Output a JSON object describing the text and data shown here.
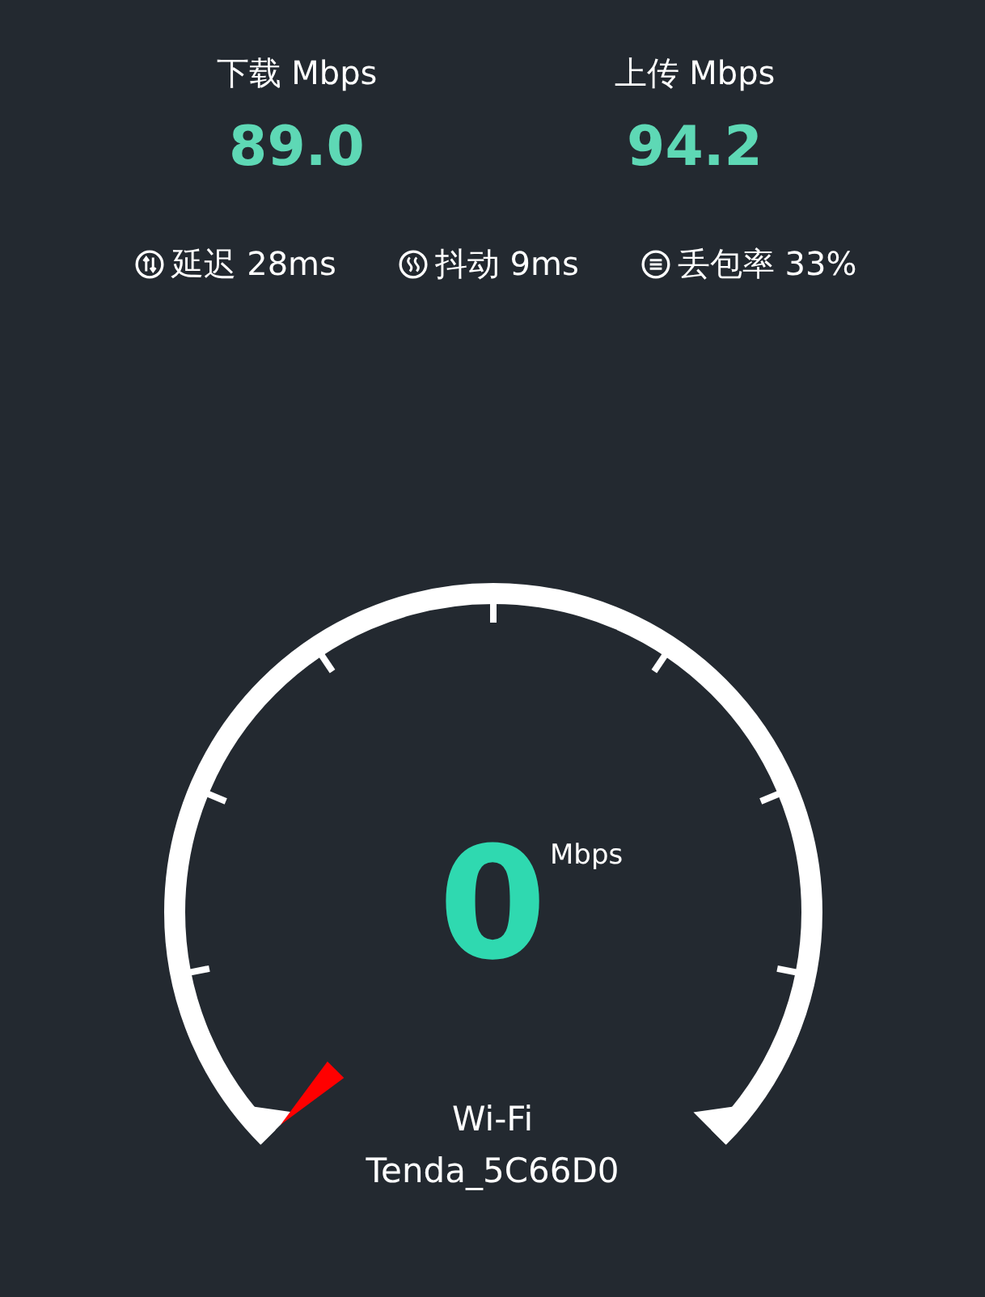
{
  "rates": [
    {
      "label": "下载 Mbps",
      "value": "89.0"
    },
    {
      "label": "上传 Mbps",
      "value": "94.2"
    }
  ],
  "metrics": [
    {
      "kind": "latency",
      "label": "延迟 28ms"
    },
    {
      "kind": "jitter",
      "label": "抖动 9ms"
    },
    {
      "kind": "loss",
      "label": "丢包率 33%"
    }
  ],
  "gauge": {
    "speed": "0",
    "unit": "Mbps",
    "network": "Wi-Fi",
    "ssid": "Tenda_5C66D0"
  }
}
